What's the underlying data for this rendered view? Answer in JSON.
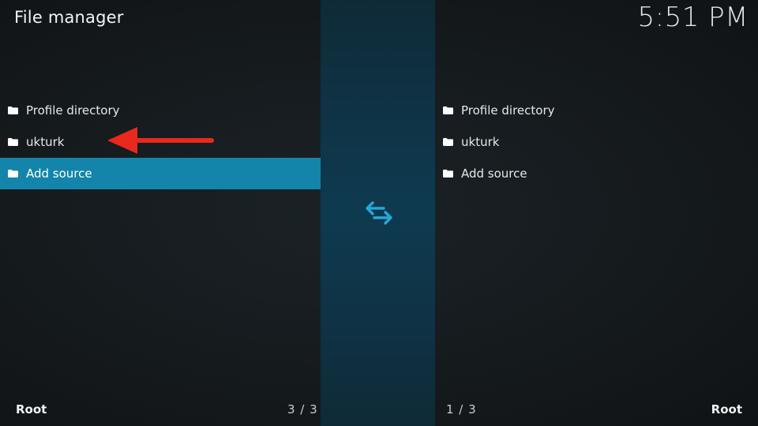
{
  "header": {
    "title": "File manager",
    "clock": "5:51 PM"
  },
  "left_pane": {
    "items": [
      {
        "label": "Profile directory",
        "icon": "folder-icon"
      },
      {
        "label": "ukturk",
        "icon": "folder-icon"
      },
      {
        "label": "Add source",
        "icon": "folder-icon"
      }
    ],
    "selected_index": 2,
    "path": "Root",
    "count": "3 / 3"
  },
  "right_pane": {
    "items": [
      {
        "label": "Profile directory",
        "icon": "folder-icon"
      },
      {
        "label": "ukturk",
        "icon": "folder-icon"
      },
      {
        "label": "Add source",
        "icon": "folder-icon"
      }
    ],
    "path": "Root",
    "count": "1 / 3"
  },
  "center": {
    "icon": "swap-arrows-icon"
  },
  "colors": {
    "highlight": "#1385ab",
    "accent_icon": "#2aa6d6",
    "annotation_arrow": "#e8291c"
  }
}
